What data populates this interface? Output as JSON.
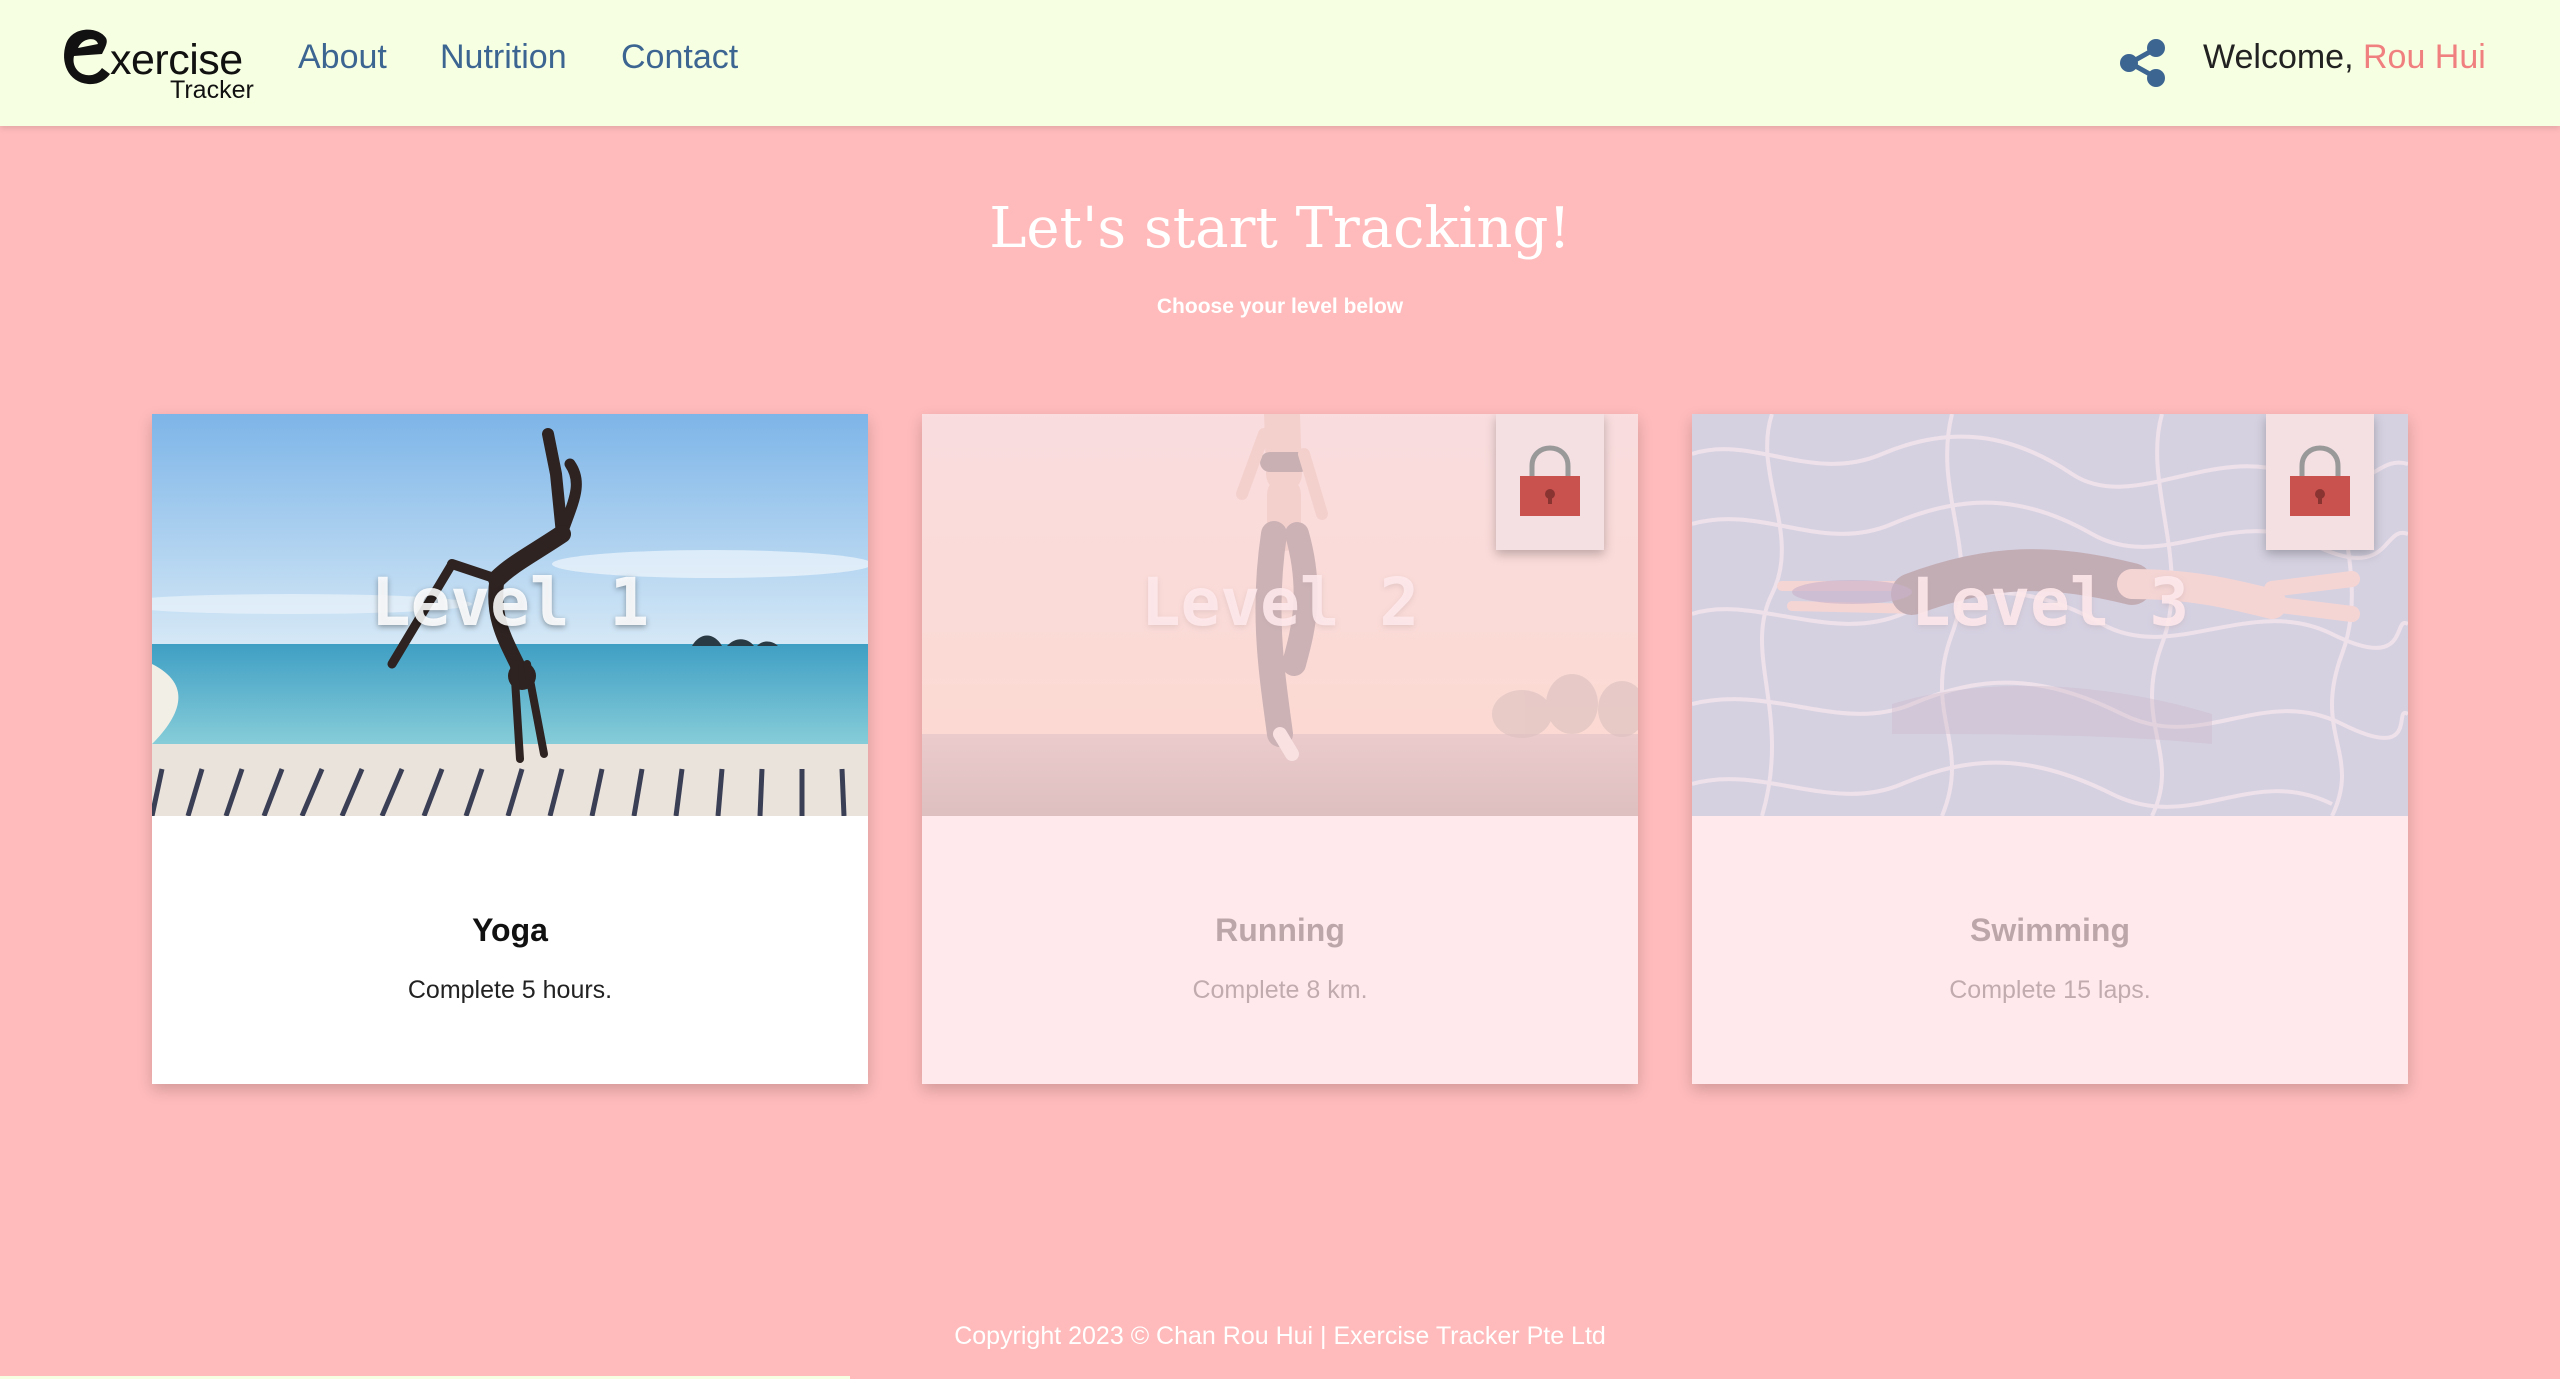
{
  "brand": {
    "logo_letter": "e",
    "word": "xercise",
    "sub": "Tracker"
  },
  "nav": {
    "links": [
      {
        "label": "About"
      },
      {
        "label": "Nutrition"
      },
      {
        "label": "Contact"
      }
    ]
  },
  "user": {
    "welcome_prefix": "Welcome, ",
    "name": "Rou Hui"
  },
  "hero": {
    "title": "Let's start Tracking!",
    "subtitle": "Choose your level below"
  },
  "cards": [
    {
      "level": "Level 1",
      "activity": "Yoga",
      "goal": "Complete 5 hours.",
      "locked": false
    },
    {
      "level": "Level 2",
      "activity": "Running",
      "goal": "Complete 8 km.",
      "locked": true
    },
    {
      "level": "Level 3",
      "activity": "Swimming",
      "goal": "Complete 15 laps.",
      "locked": true
    }
  ],
  "footer": {
    "text": "Copyright 2023 © Chan Rou Hui | Exercise Tracker Pte Ltd"
  },
  "colors": {
    "background": "#ffbbbb",
    "navbar": "#f7ffe2",
    "nav_link": "#3c6592",
    "username": "#f08080",
    "lock": "#c9524f"
  },
  "icons": {
    "share": "share-icon",
    "lock": "lock-icon"
  }
}
